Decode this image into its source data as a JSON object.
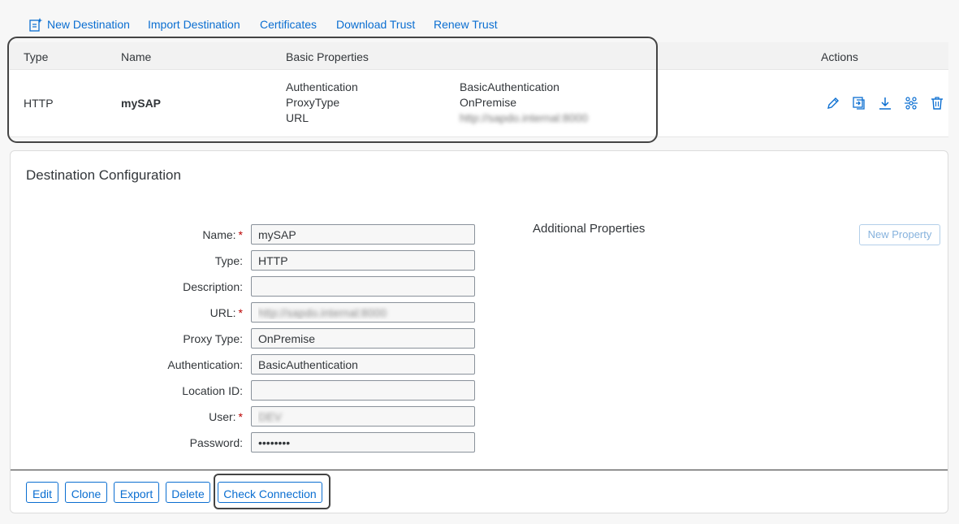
{
  "toolbar": {
    "new_destination": "New Destination",
    "import_destination": "Import Destination",
    "certificates": "Certificates",
    "download_trust": "Download Trust",
    "renew_trust": "Renew Trust"
  },
  "table": {
    "headers": {
      "type": "Type",
      "name": "Name",
      "basic_properties": "Basic Properties",
      "actions": "Actions"
    },
    "row": {
      "type": "HTTP",
      "name": "mySAP",
      "properties": [
        {
          "key": "Authentication",
          "value": "BasicAuthentication"
        },
        {
          "key": "ProxyType",
          "value": "OnPremise"
        },
        {
          "key": "URL",
          "value": "http://sapdo.internal:8000"
        }
      ]
    }
  },
  "config": {
    "title": "Destination Configuration",
    "fields": {
      "name": {
        "label": "Name:",
        "value": "mySAP",
        "required": "*"
      },
      "type": {
        "label": "Type:",
        "value": "HTTP"
      },
      "description": {
        "label": "Description:",
        "value": ""
      },
      "url": {
        "label": "URL:",
        "value": "http://sapdo.internal:8000",
        "required": "*"
      },
      "proxy_type": {
        "label": "Proxy Type:",
        "value": "OnPremise"
      },
      "authentication": {
        "label": "Authentication:",
        "value": "BasicAuthentication"
      },
      "location_id": {
        "label": "Location ID:",
        "value": ""
      },
      "user": {
        "label": "User:",
        "value": "DEV",
        "required": "*"
      },
      "password": {
        "label": "Password:",
        "value": "••••••••"
      }
    },
    "additional_properties": "Additional Properties",
    "new_property": "New Property",
    "buttons": {
      "edit": "Edit",
      "clone": "Clone",
      "export": "Export",
      "delete": "Delete",
      "check_connection": "Check Connection"
    }
  },
  "colors": {
    "accent": "#0a6ed1",
    "required": "#bb0000",
    "highlight_frame": "#444444"
  }
}
